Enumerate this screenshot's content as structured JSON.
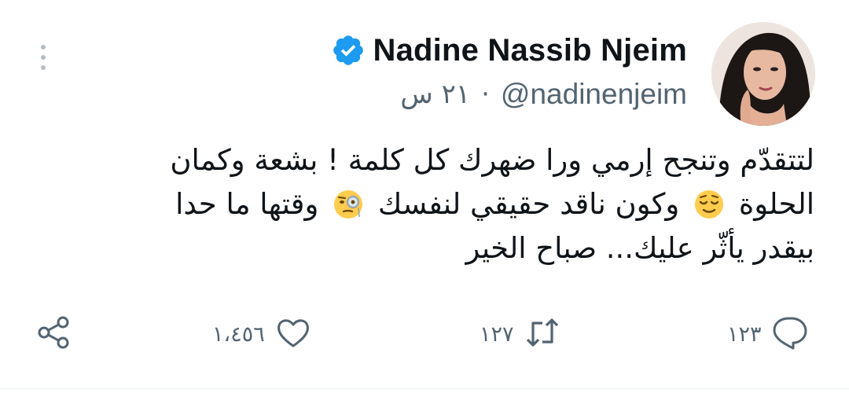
{
  "tweet": {
    "author": {
      "display_name": "Nadine Nassib Njeim",
      "handle": "@nadinenjeim",
      "verified": true
    },
    "time": "٢١ س",
    "separator": "·",
    "body_lines": [
      {
        "text": "لتتقدّم وتنجح إرمي ورا ضهرك كل كلمة ! بشعة وكمان"
      },
      {
        "before": "الحلوة",
        "emoji1": "relieved-face-emoji",
        "middle": "وكون ناقد حقيقي لنفسك",
        "emoji2": "face-with-monocle-emoji",
        "after": "وقتها ما حدا"
      },
      {
        "text": "بيقدر يأثّر عليك... صباح الخير"
      }
    ],
    "actions": {
      "replies": "١٢٣",
      "retweets": "١٢٧",
      "likes": "١،٤٥٦"
    },
    "icons": {
      "verified": "verified-badge-icon",
      "more": "more-vertical-icon",
      "reply": "reply-icon",
      "retweet": "retweet-icon",
      "like": "heart-icon",
      "share": "share-icon"
    },
    "colors": {
      "verified_badge": "#1d9bf0",
      "secondary_text": "#536471",
      "primary_text": "#0f1419",
      "emoji_yellow": "#ffcc4d"
    }
  }
}
